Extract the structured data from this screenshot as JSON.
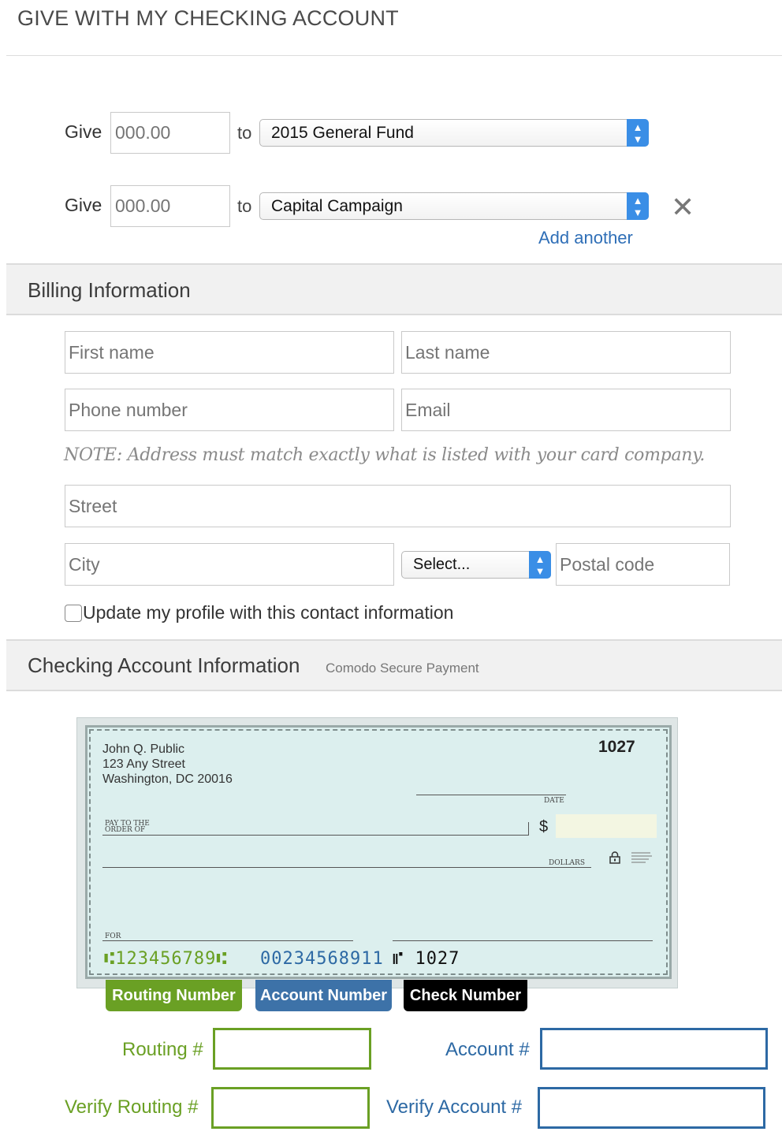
{
  "page": {
    "title": "GIVE WITH MY CHECKING ACCOUNT"
  },
  "gifts": [
    {
      "give_label": "Give",
      "amount_placeholder": "000.00",
      "to_label": "to",
      "fund": "2015 General Fund"
    },
    {
      "give_label": "Give",
      "amount_placeholder": "000.00",
      "to_label": "to",
      "fund": "Capital Campaign"
    }
  ],
  "add_another": "Add another",
  "billing": {
    "title": "Billing Information",
    "first_name_placeholder": "First name",
    "last_name_placeholder": "Last name",
    "phone_placeholder": "Phone number",
    "email_placeholder": "Email",
    "note": "NOTE: Address must match exactly what is listed with your card company.",
    "street_placeholder": "Street",
    "city_placeholder": "City",
    "state_select": "Select...",
    "postal_placeholder": "Postal code",
    "update_profile_label": "Update my profile with this contact information"
  },
  "checking": {
    "title": "Checking Account Information",
    "subtitle": "Comodo Secure Payment",
    "check": {
      "name": "John Q. Public",
      "street": "123 Any Street",
      "city": "Washington, DC 20016",
      "number": "1027",
      "date_label": "DATE",
      "pay_to_1": "PAY TO THE",
      "pay_to_2": "ORDER OF",
      "dollar_sign": "$",
      "dollars_label": "DOLLARS",
      "for_label": "FOR",
      "routing_micr": "⑆123456789⑆",
      "account_micr": "00234568911",
      "check_micr": "⑈ 1027"
    },
    "tags": {
      "routing": "Routing Number",
      "account": "Account Number",
      "check": "Check Number"
    },
    "routing_label": "Routing #",
    "verify_routing_label": "Verify Routing #",
    "account_label": "Account #",
    "verify_account_label": "Verify Account #"
  },
  "colors": {
    "routing": "#6aa024",
    "account": "#2d69a4",
    "select_accent": "#3a8ee6",
    "link": "#2f6fb7"
  },
  "icons": {
    "remove": "close-icon",
    "select": "updown-chevron-icon",
    "lock": "lock-icon"
  }
}
